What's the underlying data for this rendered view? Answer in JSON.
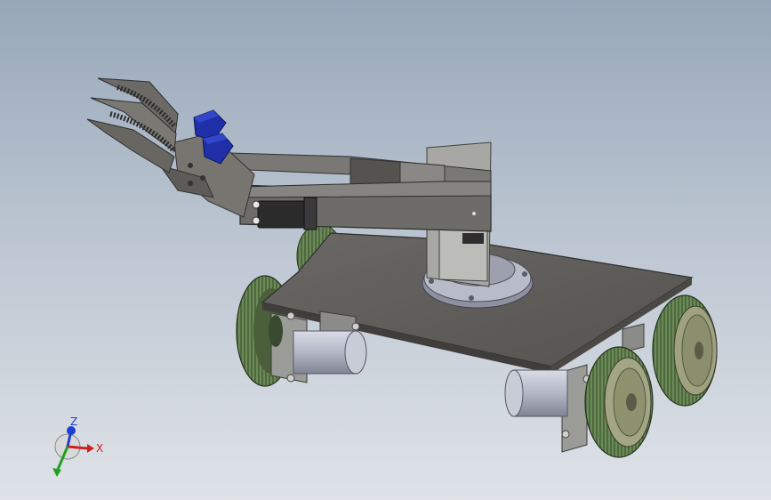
{
  "viewport": {
    "background_top": "#97a7b9",
    "background_bottom": "#dfe3e8"
  },
  "model": {
    "plate_color": "#5f5d5a",
    "arm_color": "#6b6966",
    "bracket_color": "#a6a6a2",
    "servo_color": "#2d2d2d",
    "blue_servo_color": "#1f2fa8",
    "tire_color": "#4f6a3f",
    "motor_color": "#b8bcc8",
    "base_color": "#9ea1ad"
  },
  "triad": {
    "z_label": "Z",
    "x_label": "X",
    "z_color": "#1f3fd0",
    "x_color": "#d02020",
    "y_color": "#20a020"
  }
}
